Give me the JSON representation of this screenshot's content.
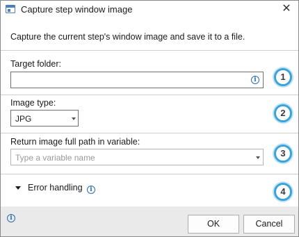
{
  "window": {
    "title": "Capture step window image",
    "close_glyph": "✕"
  },
  "description": "Capture the current step's window image and save it to a file.",
  "target_folder": {
    "label": "Target folder:",
    "value": "",
    "info_icon": "info-icon",
    "badge": "1"
  },
  "image_type": {
    "label": "Image type:",
    "selected": "JPG",
    "badge": "2"
  },
  "return_path": {
    "label": "Return image full path in variable:",
    "placeholder": "Type a variable name",
    "badge": "3"
  },
  "error_handling": {
    "label": "Error handling",
    "badge": "4"
  },
  "footer": {
    "ok_label": "OK",
    "cancel_label": "Cancel"
  },
  "colors": {
    "badge_ring": "#3ba3d8",
    "info_blue": "#2b6cb0",
    "footer_bg": "#eaeaea"
  }
}
